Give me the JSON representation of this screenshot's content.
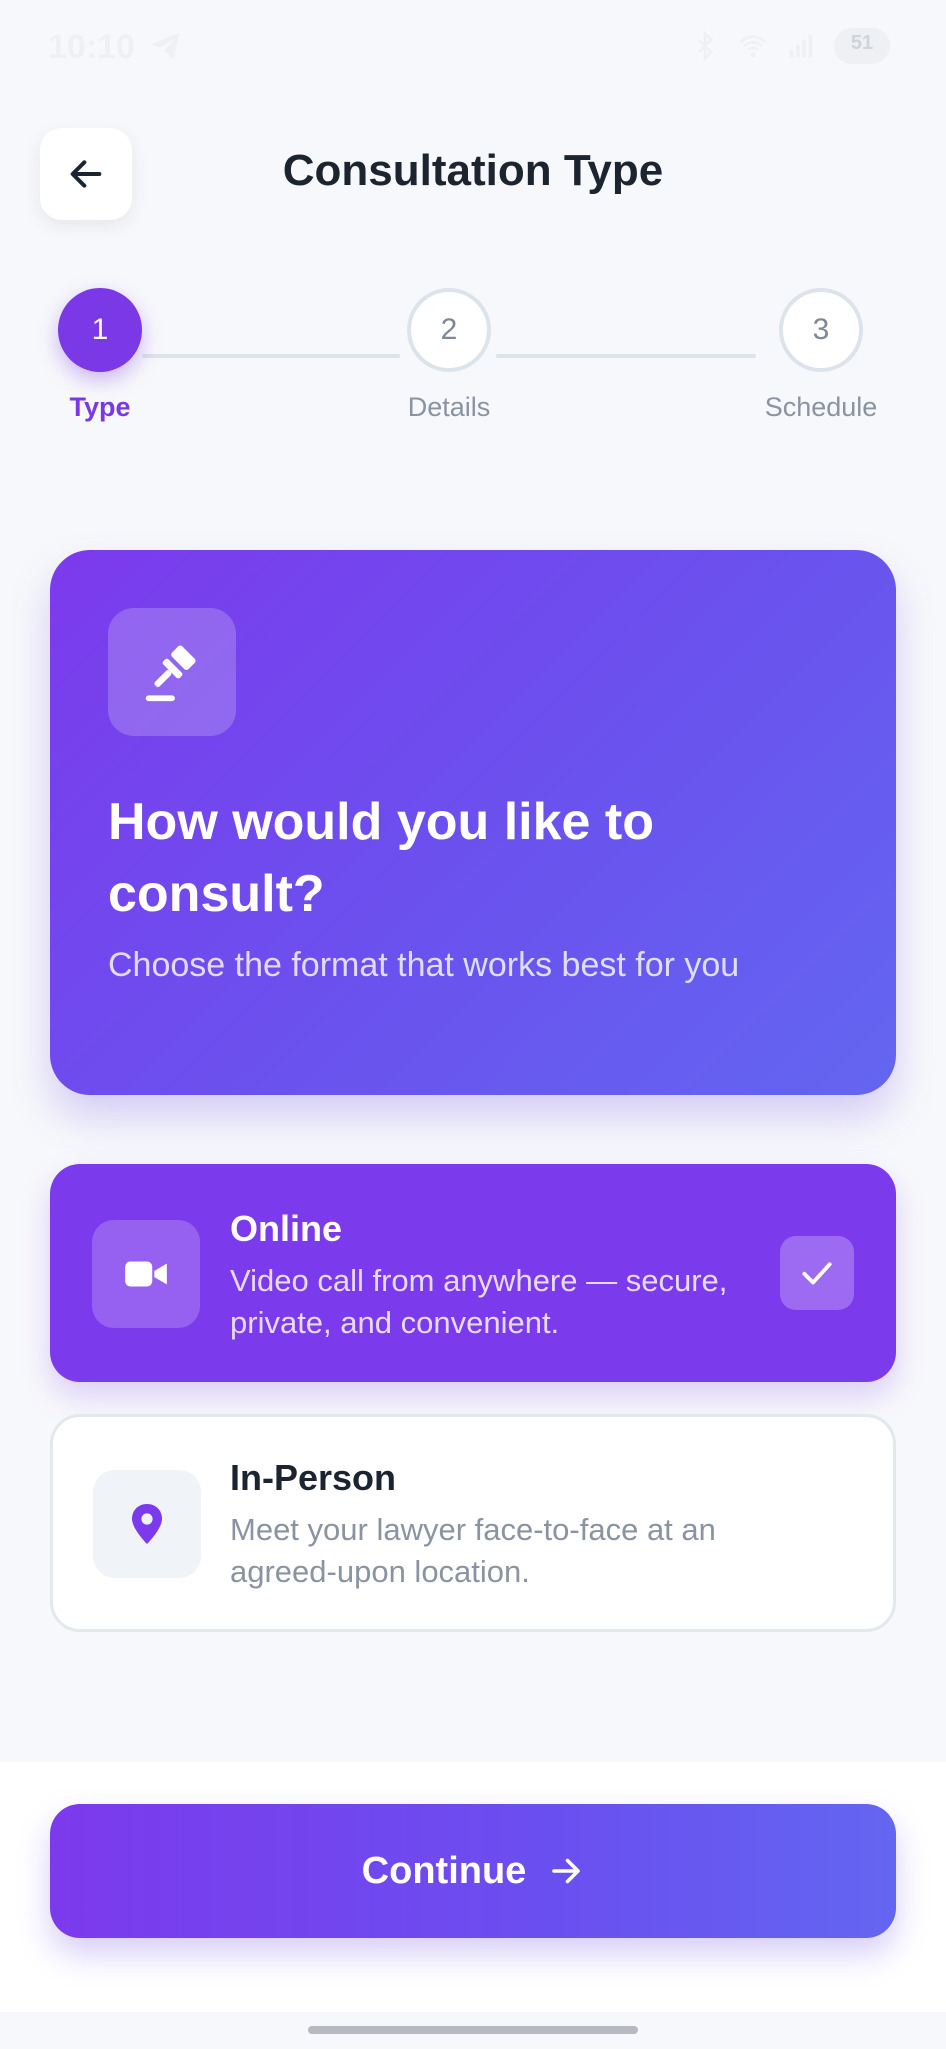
{
  "status_bar": {
    "time": "10:10",
    "battery": "51"
  },
  "header": {
    "title": "Consultation Type"
  },
  "stepper": {
    "current_step": 1,
    "steps": [
      {
        "number": "1",
        "label": "Type"
      },
      {
        "number": "2",
        "label": "Details"
      },
      {
        "number": "3",
        "label": "Schedule"
      }
    ]
  },
  "hero": {
    "icon": "gavel-icon",
    "title": "How would you like to consult?",
    "subtitle": "Choose the format that works best for you"
  },
  "options": [
    {
      "icon": "video-camera-icon",
      "title": "Online",
      "description": "Video call from anywhere — secure, private, and convenient.",
      "selected": true
    },
    {
      "icon": "map-pin-icon",
      "title": "In-Person",
      "description": "Meet your lawyer face-to-face at an agreed-upon location.",
      "selected": false
    }
  ],
  "footer": {
    "continue_label": "Continue"
  },
  "colors": {
    "accent": "#7c3aed",
    "accent_end": "#6366f1",
    "background": "#f7f8fb",
    "muted_text": "#8a93a1"
  }
}
